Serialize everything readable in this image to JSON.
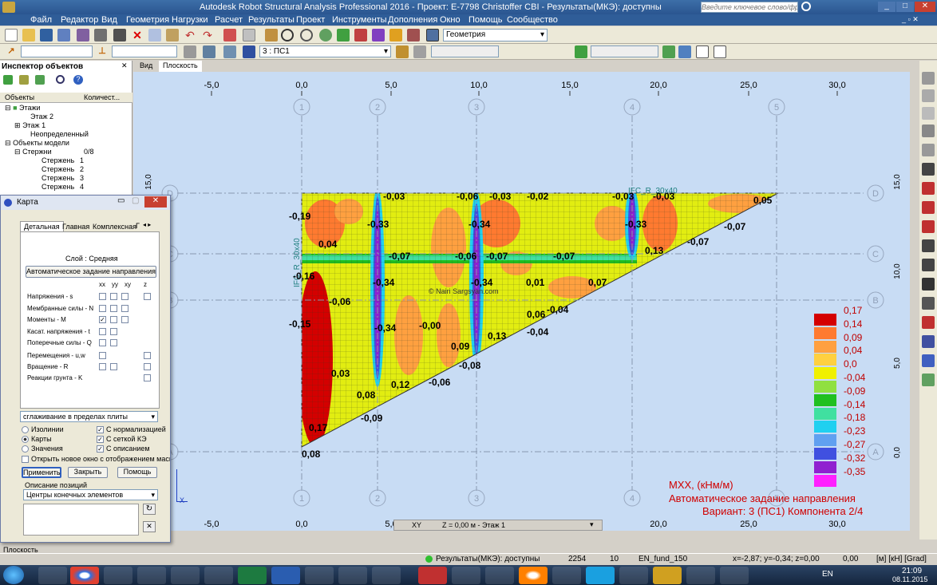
{
  "titlebar": {
    "title": "Autodesk Robot Structural Analysis Professional 2016 - Проект: E-7798 Christoffer CBI - Результаты(МКЭ): доступны",
    "search_placeholder": "Введите ключевое слово/фразу"
  },
  "menu": [
    "Файл",
    "Редактор",
    "Вид",
    "Геометрия",
    "Нагрузки",
    "Расчет",
    "Результаты",
    "Проект",
    "Инструменты",
    "Дополнения",
    "Окно",
    "Помощь",
    "Сообщество"
  ],
  "toolbar": {
    "layout_combo": "Геометрия",
    "case_combo": "3 : ПС1"
  },
  "inspector": {
    "title": "Инспектор объектов",
    "col_objects": "Объекты",
    "col_count": "Количест...",
    "tree": [
      {
        "label": "Этажи",
        "count": ""
      },
      {
        "label": "Этаж 2",
        "count": ""
      },
      {
        "label": "Этаж 1",
        "count": ""
      },
      {
        "label": "Неопределенный",
        "count": ""
      },
      {
        "label": "Объекты модели",
        "count": ""
      },
      {
        "label": "Стержни",
        "count": "0/8"
      },
      {
        "label": "Стержень",
        "count": "1"
      },
      {
        "label": "Стержень",
        "count": "2"
      },
      {
        "label": "Стержень",
        "count": "3"
      },
      {
        "label": "Стержень",
        "count": "4"
      }
    ]
  },
  "view_tabs": [
    "Вид",
    "Плоскость"
  ],
  "dialog": {
    "title": "Карта",
    "tabs": [
      "Детальная",
      "Главная",
      "Комплексная",
      "Г"
    ],
    "layer": "Слой : Средняя",
    "auto_dir_button": "Автоматическое задание направления",
    "col_heads": [
      "xx",
      "yy",
      "xy",
      "z"
    ],
    "rows": [
      "Напряжения - s",
      "Мембранные силы - N",
      "Моменты - M",
      "Касат. напряжения - t",
      "Поперечные силы - Q",
      "Перемещения - u,w",
      "Вращение - R",
      "Реакции грунта - K"
    ],
    "smoothing": "сглаживание в пределах плиты",
    "radio_isolines": "Изолинии",
    "radio_maps": "Карты",
    "radio_values": "Значения",
    "chk_normalize": "С нормализацией",
    "chk_mesh": "С сеткой КЭ",
    "chk_descr": "С описанием",
    "chk_newwin": "Открыть новое окно с отображением масшт",
    "btn_apply": "Применить",
    "btn_close": "Закрыть",
    "btn_help": "Помощь",
    "pos_label": "Описание позиций",
    "pos_combo": "Центры конечных элементов"
  },
  "view": {
    "x_ticks": [
      "-5,0",
      "0,0",
      "5,0",
      "10,0",
      "15,0",
      "20,0",
      "25,0",
      "30,0"
    ],
    "y_ticks": [
      "15,0",
      "10,0",
      "5,0",
      "0,0"
    ],
    "grid_cols": [
      "1",
      "2",
      "3",
      "4",
      "5"
    ],
    "grid_rows": [
      "D",
      "C",
      "B",
      "A"
    ],
    "beam_label": "IFC_R_30x40",
    "watermark": "© Nairi Sargsyan.com",
    "legend_values": [
      "0,17",
      "0,14",
      "0,09",
      "0,04",
      "0,0",
      "-0,04",
      "-0,09",
      "-0,14",
      "-0,18",
      "-0,23",
      "-0,27",
      "-0,32",
      "-0,35"
    ],
    "legend_colors": [
      "#d40000",
      "#ff7a30",
      "#ffa040",
      "#ffd040",
      "#f0f000",
      "#90e040",
      "#20c020",
      "#40e0a0",
      "#20d0f0",
      "#60a0f0",
      "#4050e0",
      "#9020d0",
      "#ff20ff"
    ],
    "caption_line1": "MXX, (кНм/м)",
    "caption_line2": "Автоматическое задание направления",
    "caption_line3": "Вариант: 3 (ПС1) Компонента 2/4",
    "coord_bar": "Z = 0,00 м - Этаж 1",
    "coord_xy": "XY",
    "big_values": [
      "-0,19",
      "-0,03",
      "-0,06",
      "-0,03",
      "-0,02",
      "-0,03",
      "-0,03",
      "0,05",
      "0,04",
      "-0,33",
      "-0,34",
      "-0,33",
      "-0,07",
      "-0,06",
      "-0,07",
      "-0,07",
      "0,13",
      "-0,16",
      "-0,34",
      "-0,34",
      "0,01",
      "0,07",
      "-0,06",
      "-0,15",
      "-0,34",
      "-0,00",
      "0,06",
      "-0,04",
      "0,03",
      "0,09",
      "0,13",
      "-0,04",
      "0,08",
      "0,12",
      "-0,08",
      "-0,06",
      "0,17",
      "-0,09",
      "0,08",
      "-0,07",
      "-0,07"
    ]
  },
  "status": {
    "left": "Плоскость",
    "results": "Результаты(МКЭ): доступны",
    "n1": "2254",
    "n2": "10",
    "n3": "EN_fund_150",
    "coords": "x=-2,87; y=-0,34; z=0,00",
    "angle": "0,00",
    "units": "[м] [кН] [Grad]"
  },
  "taskbar": {
    "time": "21:09",
    "date": "08.11.2015",
    "lang": "EN"
  }
}
